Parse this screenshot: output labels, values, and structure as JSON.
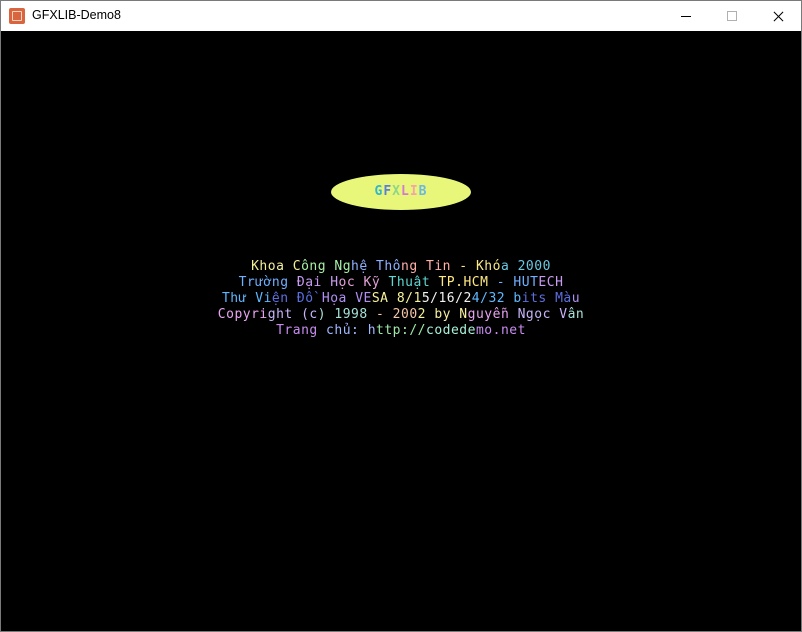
{
  "window": {
    "title": "GFXLIB-Demo8",
    "icons": [
      "app-icon",
      "minimize-icon",
      "maximize-icon",
      "close-icon"
    ]
  },
  "canvas": {
    "background": "#000000",
    "logo": {
      "text": "GFXLIB",
      "fill": "#e8f77a",
      "letter_colors": [
        "#34b6c6",
        "#5a7dd8",
        "#8fd68a",
        "#d67ad1",
        "#f3a6a6",
        "#6db8e0"
      ]
    },
    "credits": [
      {
        "text": "Khoa Công Nghệ Thông Tin - Khóa 2000",
        "colors": [
          "#f3f09a",
          "#a8f0a8",
          "#8fb0ff",
          "#ffb0a8",
          "#f8e88a",
          "#6ac7e0"
        ]
      },
      {
        "text": "Trường Đại Học Kỹ Thuật TP.HCM - HUTECH",
        "colors": [
          "#6fb0ff",
          "#c89cf2",
          "#e2a2d8",
          "#5fd7d0",
          "#ffe882"
        ]
      },
      {
        "text": "Thư Viện Đồ Họa VESA 8/15/16/24/32 bits Màu",
        "colors": [
          "#5fb8ff",
          "#5c6fe0",
          "#b28ff5",
          "#f6f29a",
          "#f2f2f2"
        ]
      },
      {
        "text": "Copyright (c) 1998 - 2002 by Nguyễn Ngọc Vân",
        "colors": [
          "#e8a4f0",
          "#c8b4f8",
          "#a8e0d8",
          "#f6c6a8",
          "#f8f0a0"
        ]
      },
      {
        "text": "Trang chủ: http://codedemo.net",
        "colors": [
          "#c88cf0",
          "#a0b8ff",
          "#9ee8a8",
          "#a8f0d8"
        ]
      }
    ]
  }
}
